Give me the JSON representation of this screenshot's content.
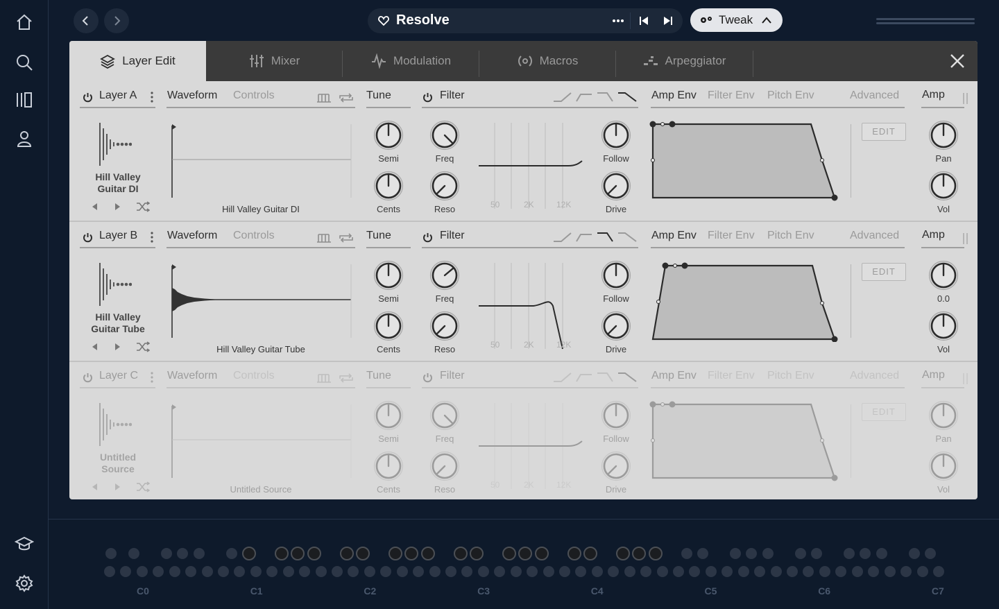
{
  "app": {
    "preset_title": "Resolve",
    "tweak_label": "Tweak"
  },
  "tabs": [
    {
      "label": "Layer Edit",
      "icon": "layers-icon",
      "active": true
    },
    {
      "label": "Mixer",
      "icon": "mixer-icon"
    },
    {
      "label": "Modulation",
      "icon": "modulation-icon"
    },
    {
      "label": "Macros",
      "icon": "macros-icon"
    },
    {
      "label": "Arpeggiator",
      "icon": "arpeggiator-icon"
    }
  ],
  "section_labels": {
    "waveform": "Waveform",
    "controls": "Controls",
    "tune": "Tune",
    "filter": "Filter",
    "amp_env": "Amp Env",
    "filter_env": "Filter Env",
    "pitch_env": "Pitch Env",
    "advanced": "Advanced",
    "amp": "Amp",
    "edit": "EDIT",
    "semi": "Semi",
    "cents": "Cents",
    "freq": "Freq",
    "reso": "Reso",
    "follow": "Follow",
    "drive": "Drive",
    "vol": "Vol",
    "freq_50": "50",
    "freq_2k": "2K",
    "freq_12k": "12K"
  },
  "layers": [
    {
      "name": "Layer A",
      "source_line1": "Hill Valley",
      "source_line2": "Guitar DI",
      "wave_name": "Hill Valley Guitar DI",
      "pan_label": "Pan",
      "enabled": true
    },
    {
      "name": "Layer B",
      "source_line1": "Hill Valley",
      "source_line2": "Guitar Tube",
      "wave_name": "Hill Valley Guitar Tube",
      "pan_label": "0.0",
      "enabled": true
    },
    {
      "name": "Layer C",
      "source_line1": "Untitled",
      "source_line2": "Source",
      "wave_name": "Untitled Source",
      "pan_label": "Pan",
      "enabled": false
    }
  ],
  "keyboard": {
    "octaves": [
      "C0",
      "C1",
      "C2",
      "C3",
      "C4",
      "C5",
      "C6",
      "C7"
    ]
  },
  "colors": {
    "background": "#0f1b2d",
    "panel": "#d9d9d9",
    "tabbar": "#3a3a3a",
    "accent": "#ffffff"
  }
}
